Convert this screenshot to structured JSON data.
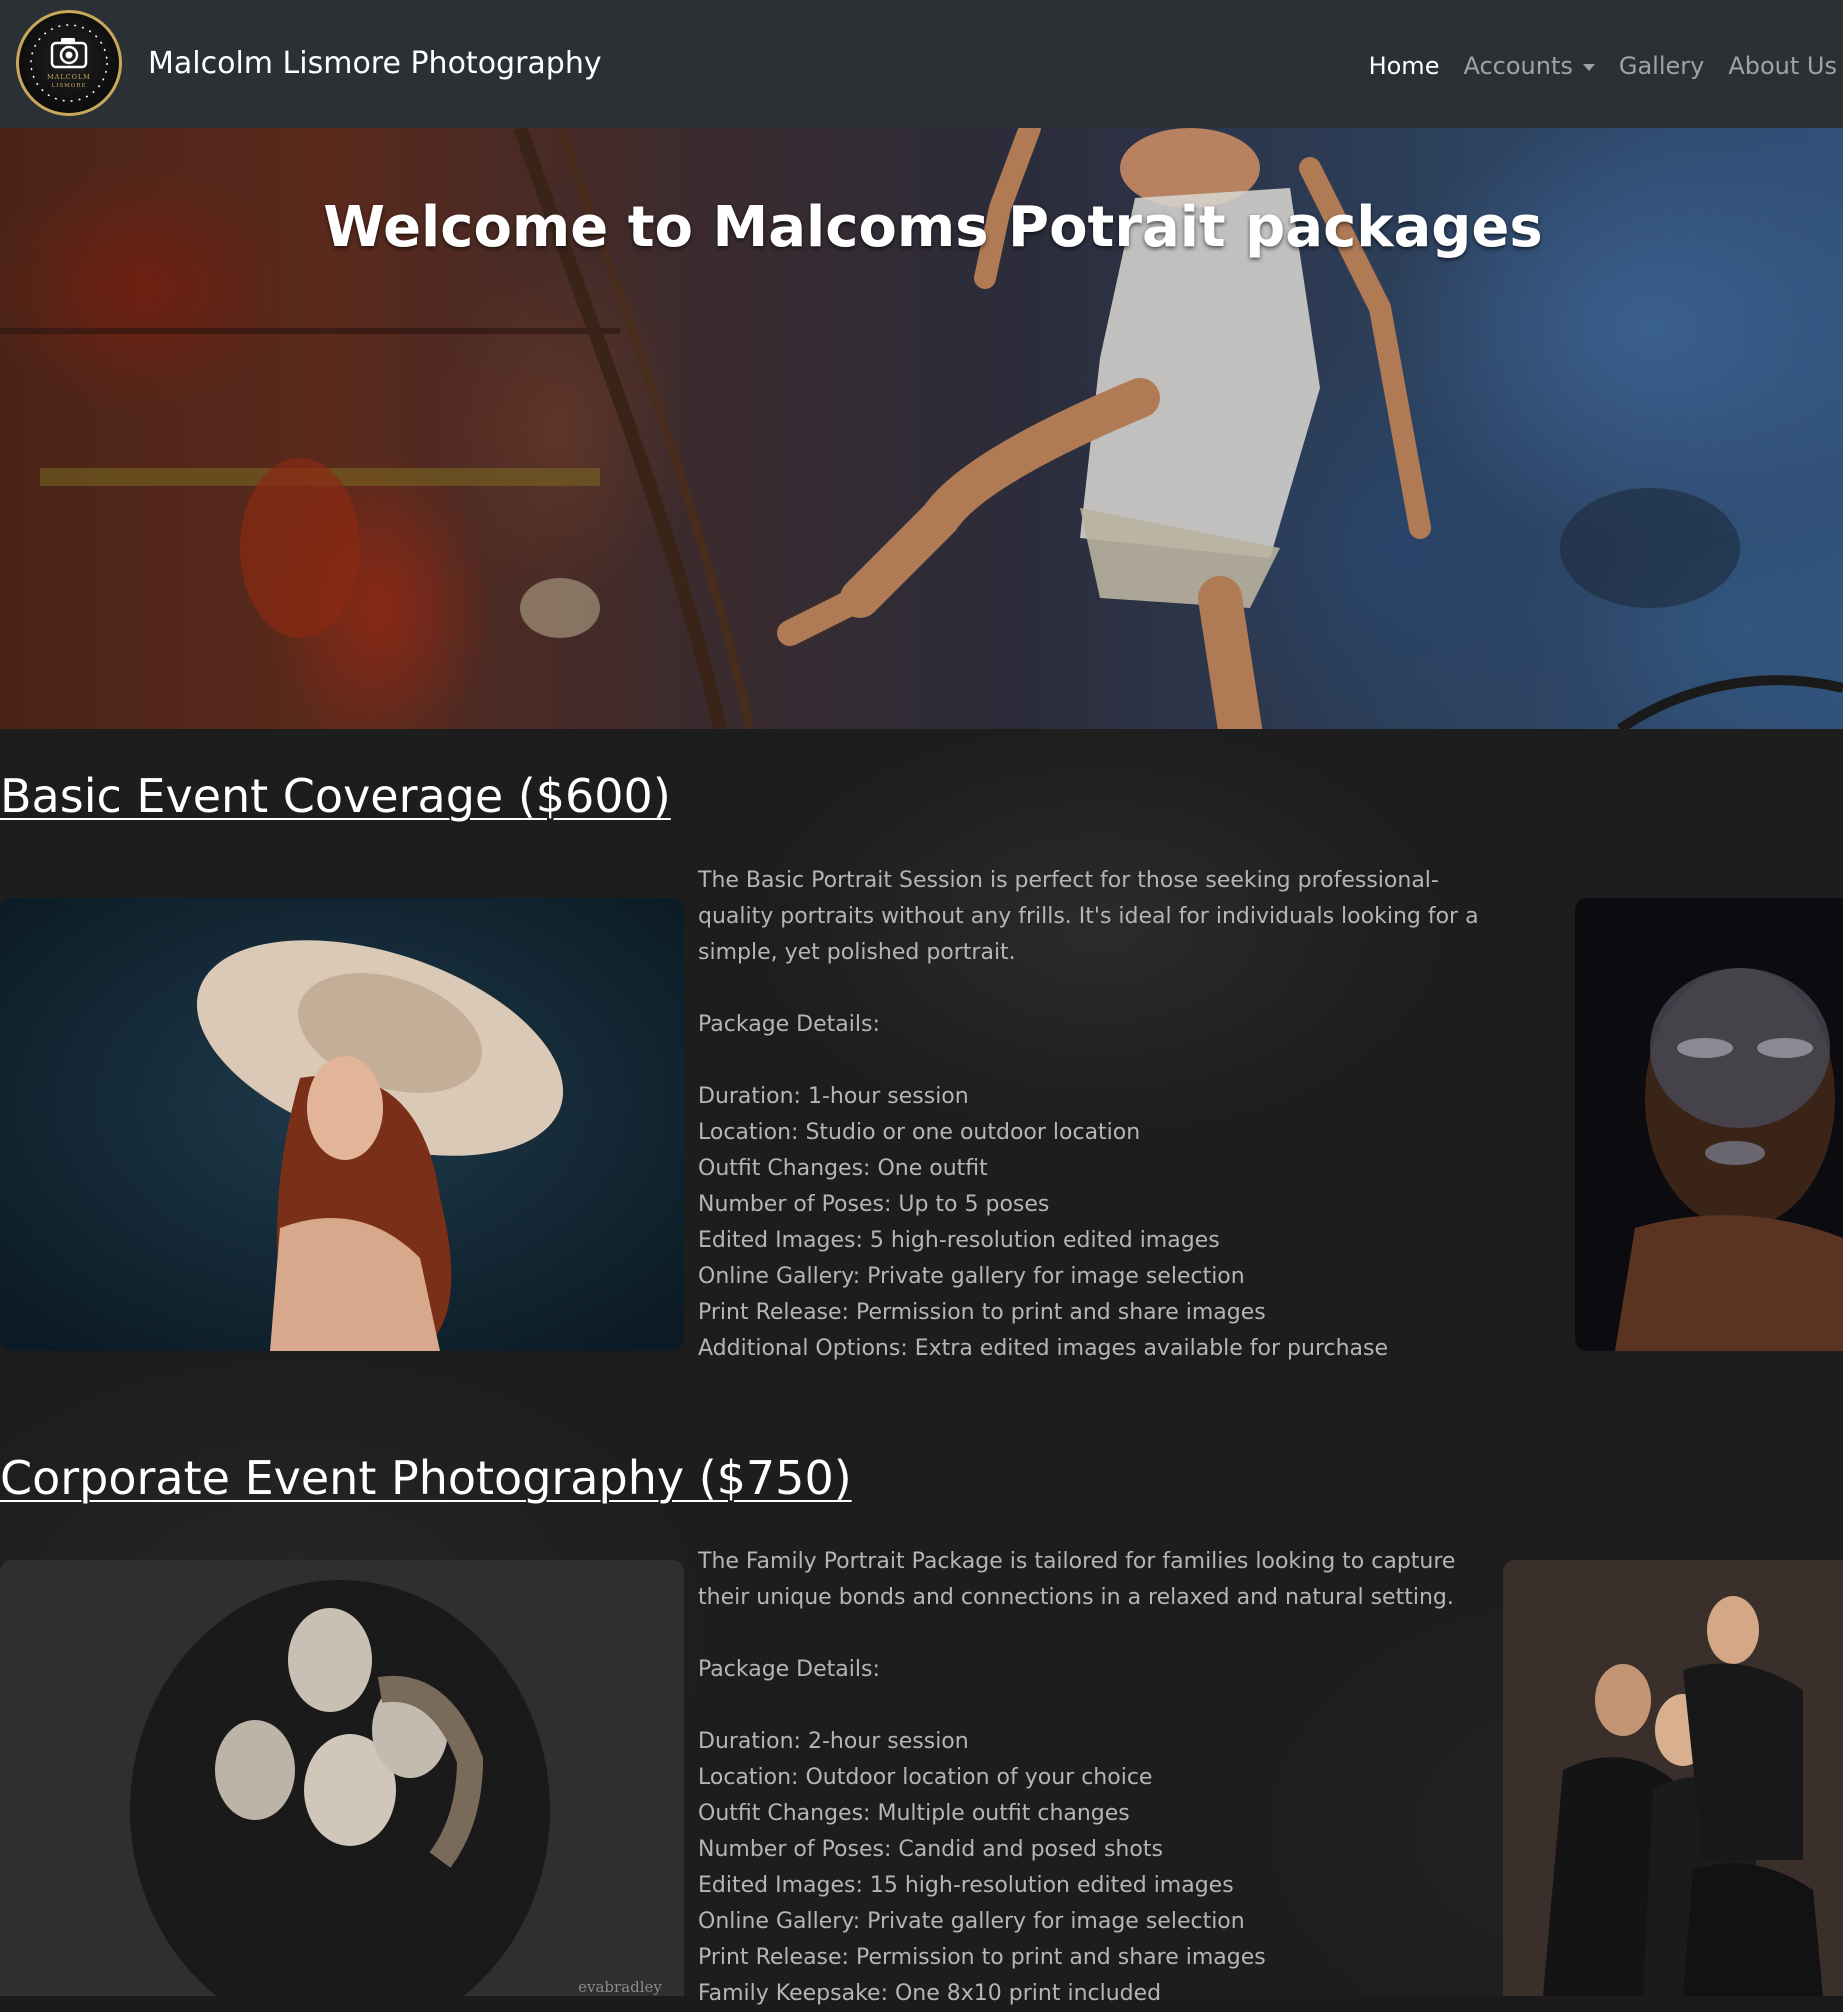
{
  "navbar": {
    "brand": "Malcolm Lismore Photography",
    "logo_text": "MALCOLM",
    "logo_subtext": "LISMORE",
    "items": [
      {
        "label": "Home",
        "active": true
      },
      {
        "label": "Accounts",
        "dropdown": true
      },
      {
        "label": "Gallery"
      },
      {
        "label": "About Us"
      }
    ],
    "background_color": "#2b3035"
  },
  "hero": {
    "title": "Welcome to Malcoms Potrait packages"
  },
  "packages": [
    {
      "title": "Basic Event Coverage ($600)",
      "intro": "The Basic Portrait Session is perfect for those seeking professional-quality portraits without any frills. It's ideal for individuals looking for a simple, yet polished portrait.",
      "details_heading": "Package Details:",
      "details": [
        "Duration: 1-hour session",
        "Location: Studio or one outdoor location",
        "Outfit Changes: One outfit",
        "Number of Poses: Up to 5 poses",
        "Edited Images: 5 high-resolution edited images",
        "Online Gallery: Private gallery for image selection",
        "Print Release: Permission to print and share images",
        "Additional Options: Extra edited images available for purchase"
      ]
    },
    {
      "title": "Corporate Event Photography ($750)",
      "intro": "The Family Portrait Package is tailored for families looking to capture their unique bonds and connections in a relaxed and natural setting.",
      "details_heading": "Package Details:",
      "details": [
        "Duration: 2-hour session",
        "Location: Outdoor location of your choice",
        "Outfit Changes: Multiple outfit changes",
        "Number of Poses: Candid and posed shots",
        "Edited Images: 15 high-resolution edited images",
        "Online Gallery: Private gallery for image selection",
        "Print Release: Permission to print and share images",
        "Family Keepsake: One 8x10 print included"
      ]
    }
  ],
  "watermark": "evabradley"
}
